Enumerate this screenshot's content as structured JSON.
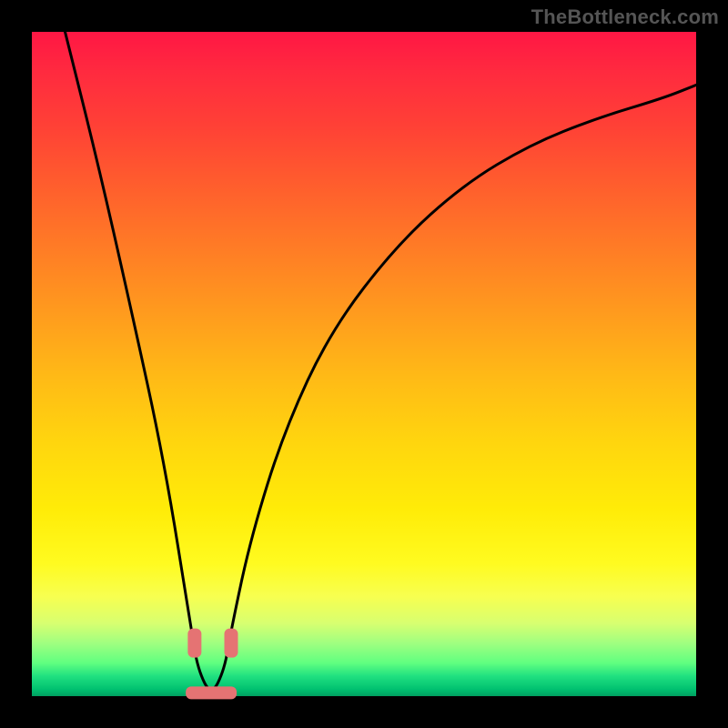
{
  "watermark": "TheBottleneck.com",
  "colors": {
    "frame": "#000000",
    "watermark_text": "#555555",
    "curve_stroke": "#000000",
    "marker_fill": "#e57373",
    "gradient_stops": [
      "#ff1744",
      "#ff7a26",
      "#ffd60e",
      "#fffb20",
      "#00c070"
    ]
  },
  "chart_data": {
    "type": "line",
    "title": "",
    "xlabel": "",
    "ylabel": "",
    "xlim": [
      0,
      100
    ],
    "ylim": [
      0,
      100
    ],
    "grid": false,
    "legend": false,
    "annotations": [],
    "description": "Bottleneck curve: V-shaped profile with minimum near x≈27, y≈0; left branch rises steeply to top-left, right branch rises with decreasing slope toward top-right.",
    "series": [
      {
        "name": "bottleneck_curve",
        "x": [
          5,
          10,
          15,
          20,
          24,
          25,
          27,
          29,
          30,
          33,
          38,
          45,
          55,
          65,
          75,
          85,
          95,
          100
        ],
        "y": [
          100,
          80,
          58,
          35,
          10,
          4,
          0,
          4,
          10,
          24,
          40,
          55,
          68,
          77,
          83,
          87,
          90,
          92
        ]
      }
    ],
    "markers": [
      {
        "name": "left-shoulder-marker",
        "x": 24.5,
        "y": 8
      },
      {
        "name": "right-shoulder-marker",
        "x": 30.0,
        "y": 8
      },
      {
        "name": "trough-marker",
        "x": 27.0,
        "y": 0.5
      }
    ]
  }
}
